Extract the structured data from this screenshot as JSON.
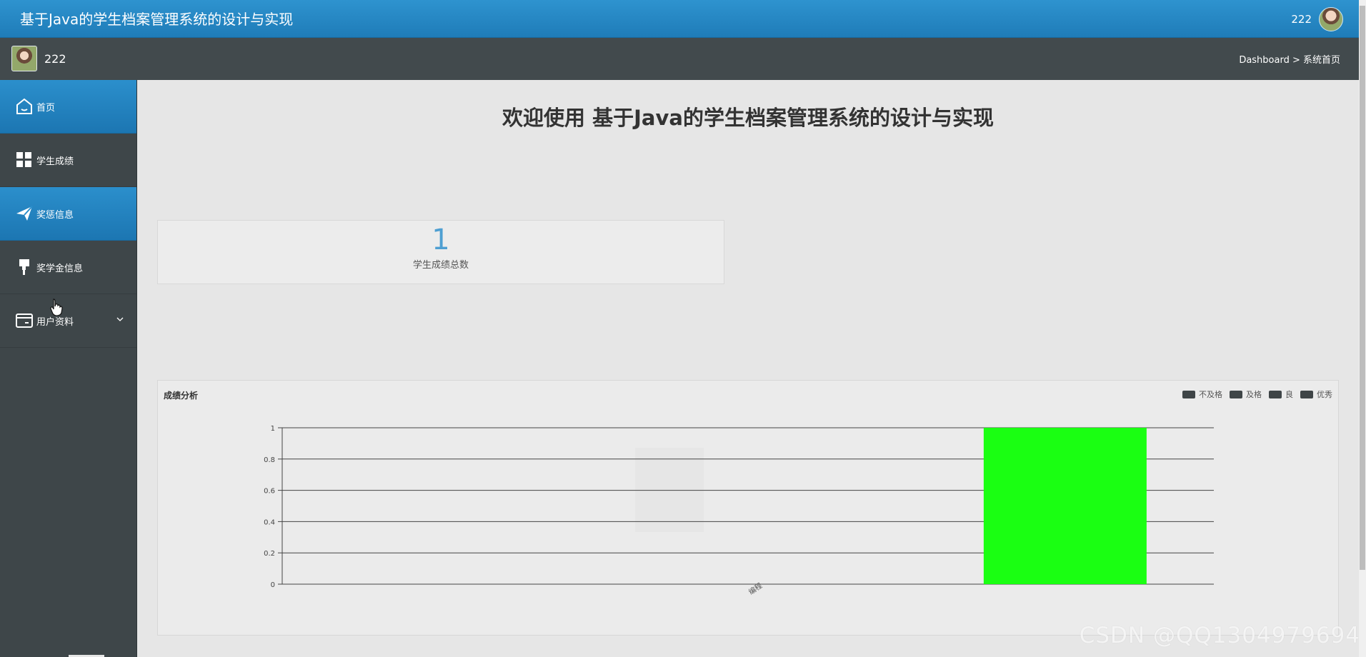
{
  "header": {
    "app_title": "基于Java的学生档案管理系统的设计与实现",
    "user_name": "222"
  },
  "subheader": {
    "profile_name": "222",
    "breadcrumb": "Dashboard > 系统首页"
  },
  "sidebar": {
    "items": [
      {
        "label": "首页",
        "icon": "home-icon"
      },
      {
        "label": "学生成绩",
        "icon": "grid-icon"
      },
      {
        "label": "奖惩信息",
        "icon": "paper-plane-icon"
      },
      {
        "label": "奖学金信息",
        "icon": "brush-icon"
      },
      {
        "label": "用户资料",
        "icon": "card-icon"
      }
    ]
  },
  "main": {
    "welcome": "欢迎使用 基于Java的学生档案管理系统的设计与实现",
    "stat": {
      "value": "1",
      "label": "学生成绩总数"
    }
  },
  "colors": {
    "header_blue": "#2b8fcc",
    "sidebar_dark": "#3e4649",
    "bar_green": "#1aff12",
    "stat_blue": "#4e9fd2"
  },
  "chart_data": {
    "type": "bar",
    "title": "成绩分析",
    "categories": [
      "编程"
    ],
    "series": [
      {
        "name": "不及格",
        "values": [
          0
        ]
      },
      {
        "name": "及格",
        "values": [
          0
        ]
      },
      {
        "name": "良",
        "values": [
          0
        ]
      },
      {
        "name": "优秀",
        "values": [
          1
        ]
      }
    ],
    "ylim": [
      0,
      1
    ],
    "yticks": [
      0,
      0.2,
      0.4,
      0.6,
      0.8,
      1
    ],
    "legend_position": "top-right",
    "grid": true
  },
  "watermark": "CSDN @QQ1304979694"
}
